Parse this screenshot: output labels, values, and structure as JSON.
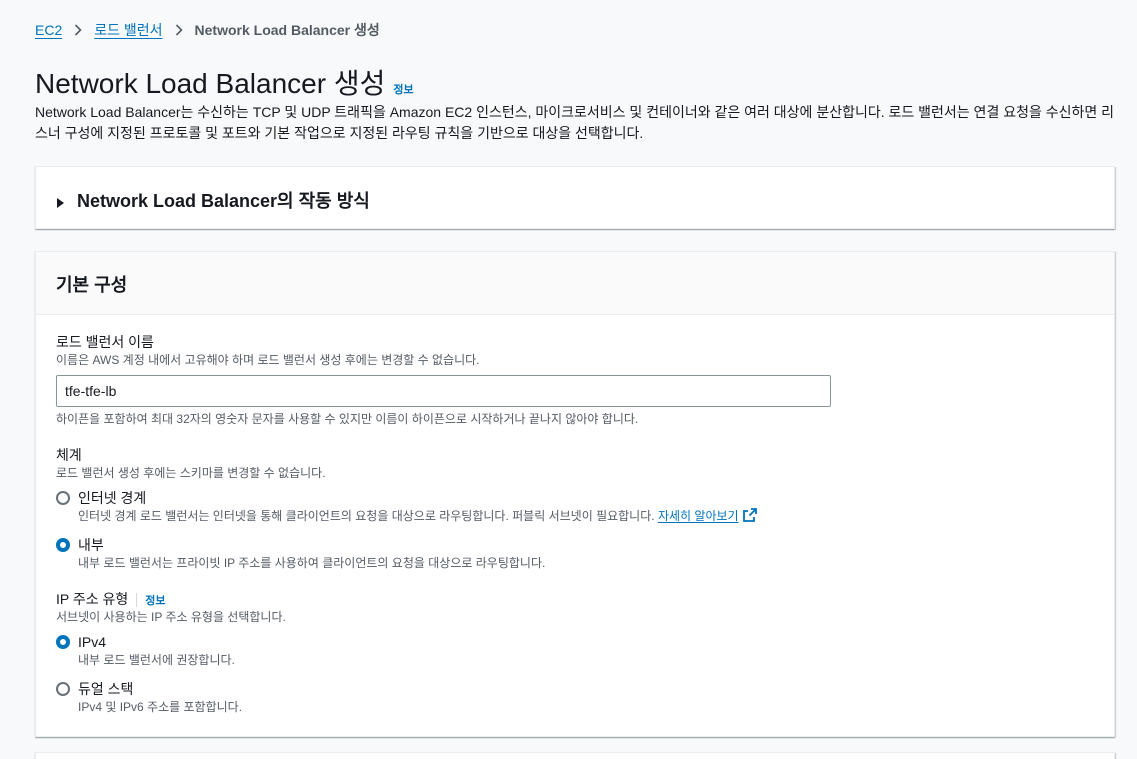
{
  "breadcrumb": {
    "items": [
      "EC2",
      "로드 밸런서"
    ],
    "current": "Network Load Balancer 생성"
  },
  "header": {
    "title": "Network Load Balancer 생성",
    "info": "정보",
    "description": "Network Load Balancer는 수신하는 TCP 및 UDP 트래픽을 Amazon EC2 인스턴스, 마이크로서비스 및 컨테이너와 같은 여러 대상에 분산합니다. 로드 밸런서는 연결 요청을 수신하면 리스너 구성에 지정된 프로토콜 및 포트와 기본 작업으로 지정된 라우팅 규칙을 기반으로 대상을 선택합니다."
  },
  "expander": {
    "title": "Network Load Balancer의 작동 방식"
  },
  "basic_config": {
    "title": "기본 구성",
    "name_field": {
      "label": "로드 밸런서 이름",
      "description": "이름은 AWS 계정 내에서 고유해야 하며 로드 밸런서 생성 후에는 변경할 수 없습니다.",
      "value": "tfe-tfe-lb",
      "constraint": "하이픈을 포함하여 최대 32자의 영숫자 문자를 사용할 수 있지만 이름이 하이픈으로 시작하거나 끝나지 않아야 합니다."
    },
    "scheme": {
      "label": "체계",
      "description": "로드 밸런서 생성 후에는 스키마를 변경할 수 없습니다.",
      "options": [
        {
          "label": "인터넷 경계",
          "desc": "인터넷 경계 로드 밸런서는 인터넷을 통해 클라이언트의 요청을 대상으로 라우팅합니다. 퍼블릭 서브넷이 필요합니다.",
          "link": "자세히 알아보기",
          "checked": false
        },
        {
          "label": "내부",
          "desc": "내부 로드 밸런서는 프라이빗 IP 주소를 사용하여 클라이언트의 요청을 대상으로 라우팅합니다.",
          "checked": true
        }
      ]
    },
    "ip_type": {
      "label": "IP 주소 유형",
      "info": "정보",
      "description": "서브넷이 사용하는 IP 주소 유형을 선택합니다.",
      "options": [
        {
          "label": "IPv4",
          "desc": "내부 로드 밸런서에 권장합니다.",
          "checked": true
        },
        {
          "label": "듀얼 스택",
          "desc": "IPv4 및 IPv6 주소를 포함합니다.",
          "checked": false
        }
      ]
    }
  },
  "colors": {
    "accent": "#0073bb",
    "text": "#16191f",
    "muted": "#545b64",
    "background": "#f8f9fa"
  }
}
